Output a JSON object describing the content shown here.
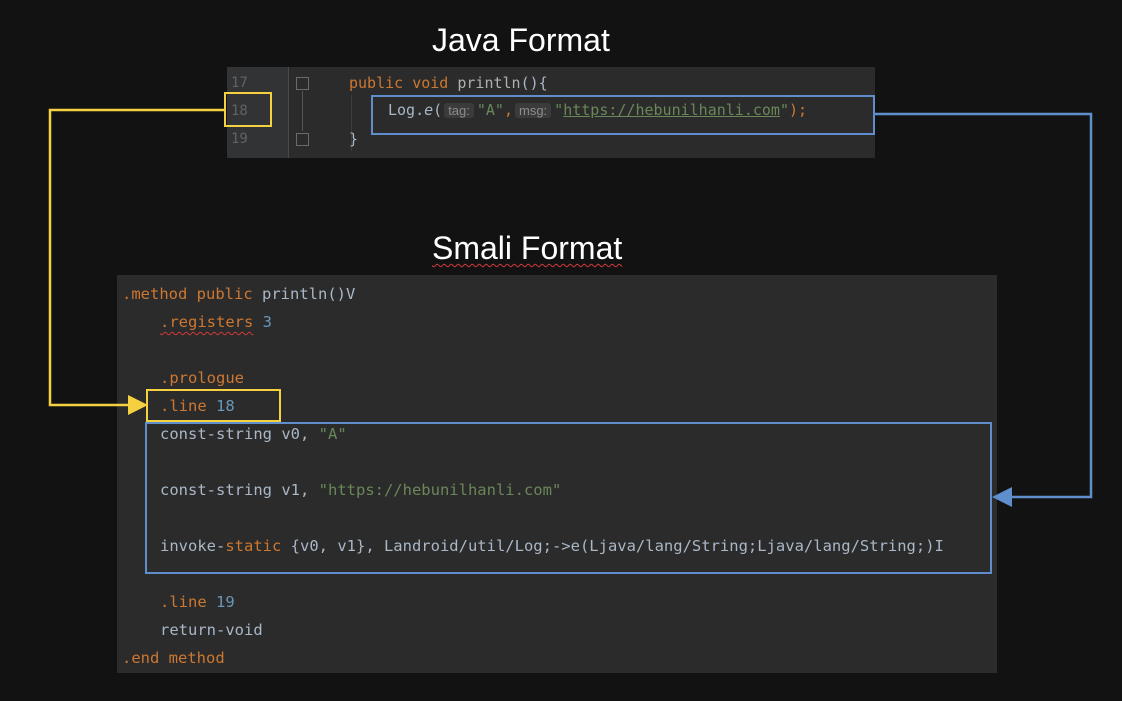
{
  "titles": {
    "java": "Java Format",
    "smali": "Smali Format"
  },
  "java": {
    "line_numbers": [
      "17",
      "18",
      "19"
    ],
    "line17": {
      "kw1": "public",
      "kw2": "void",
      "fn": "println",
      "punct": "(){"
    },
    "line18": {
      "obj": "Log.",
      "method": "e",
      "open": "(",
      "hint_tag": "tag:",
      "arg1": "\"A\"",
      "comma": ",",
      "hint_msg": "msg:",
      "q1": "\"",
      "url": "https://hebunilhanli.com",
      "q2": "\"",
      "close": ");"
    },
    "line19": {
      "brace": "}"
    }
  },
  "smali": {
    "l1": {
      "d": ".method",
      "k": "public",
      "rest": "println()V"
    },
    "l2": {
      "d": ".registers",
      "n": "3"
    },
    "l3": {
      "d": ".prologue"
    },
    "l4": {
      "d": ".line",
      "n": "18"
    },
    "l5": {
      "instr": "const-string v0,",
      "s": "\"A\""
    },
    "l6": {
      "instr": "const-string v1,",
      "s": "\"https://hebunilhanli.com\""
    },
    "l7": {
      "a": "invoke-",
      "b": "static",
      "c": " {v0, v1}, Landroid/util/Log;->e(Ljava/lang/String;Ljava/lang/String;)I"
    },
    "l8": {
      "d": ".line",
      "n": "19"
    },
    "l9": {
      "instr": "return-void"
    },
    "l10": {
      "d": ".end method"
    }
  },
  "colors": {
    "yellow": "#f5d142",
    "blue": "#5e8fcc",
    "keyword": "#cc7832",
    "string": "#6a8759",
    "number": "#6897bb"
  }
}
